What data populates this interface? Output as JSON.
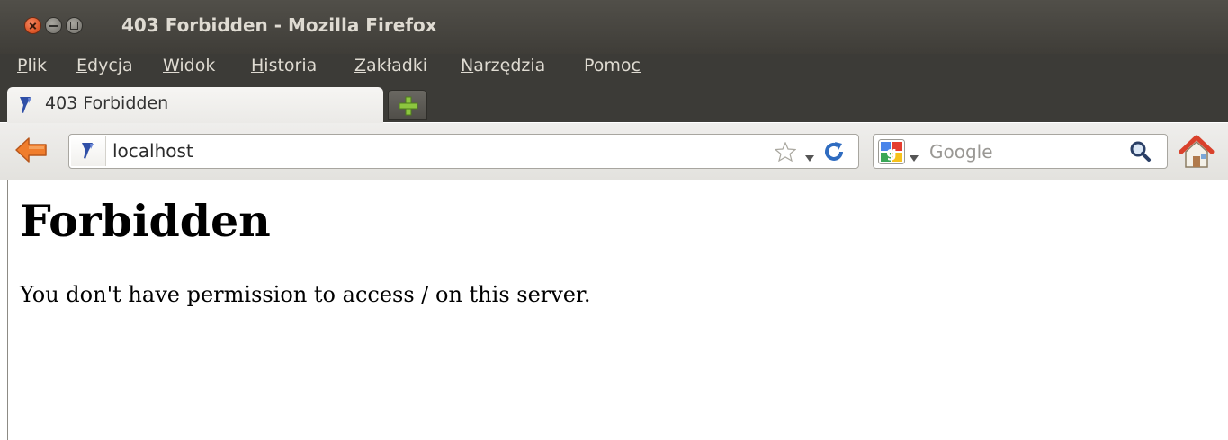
{
  "window": {
    "title": "403 Forbidden - Mozilla Firefox",
    "controls": [
      "close-icon",
      "minimize-icon",
      "maximize-icon"
    ]
  },
  "menubar": {
    "items": [
      {
        "accel": "P",
        "rest": "lik"
      },
      {
        "accel": "E",
        "rest": "dycja"
      },
      {
        "accel": "W",
        "rest": "idok"
      },
      {
        "accel": "H",
        "rest": "istoria"
      },
      {
        "accel": "Z",
        "rest": "akładki"
      },
      {
        "accel": "N",
        "rest": "arzędzia"
      },
      {
        "pre": "Pomo",
        "accel": "c"
      }
    ]
  },
  "tabs": [
    {
      "label": "403 Forbidden",
      "icon": "apache-feather-icon",
      "active": true
    }
  ],
  "newtab": {
    "icon": "plus-icon"
  },
  "navbar": {
    "back_icon": "back-arrow-icon",
    "url": "localhost",
    "site_icon": "apache-feather-icon",
    "bookmark_icon": "star-icon",
    "reload_icon": "reload-icon",
    "search": {
      "engine_icon": "google-icon",
      "placeholder": "Google"
    },
    "home_icon": "home-icon"
  },
  "page": {
    "heading": "Forbidden",
    "message": "You don't have permission to access / on this server."
  },
  "colors": {
    "titlebar": "#3c3b37",
    "title_text": "#dfdbd2",
    "close_button": "#e05a2b",
    "back_arrow": "#f07d2c",
    "home_roof": "#d9412b",
    "plus_green": "#8cc63f"
  }
}
